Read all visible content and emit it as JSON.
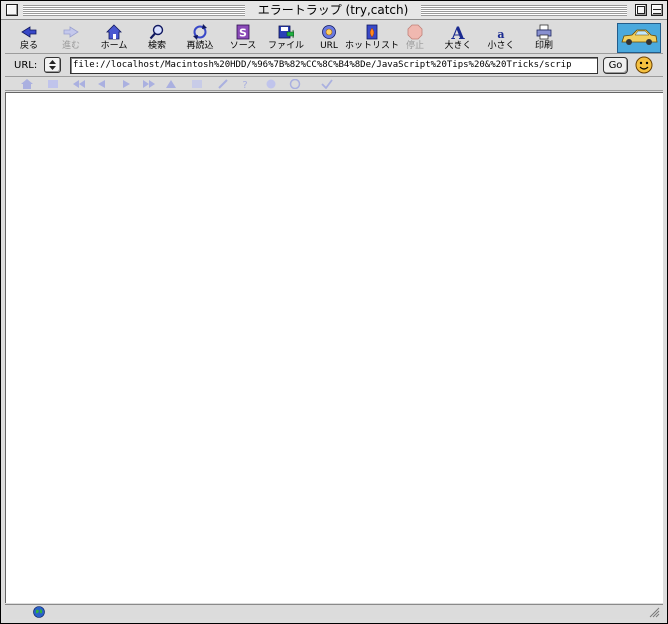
{
  "window": {
    "title": "エラートラップ (try,catch)"
  },
  "toolbar": {
    "buttons": [
      {
        "label": "戻る",
        "icon": "back-icon",
        "enabled": true
      },
      {
        "label": "進む",
        "icon": "forward-icon",
        "enabled": false
      },
      {
        "label": "ホーム",
        "icon": "home-icon",
        "enabled": true
      },
      {
        "label": "検索",
        "icon": "search-icon",
        "enabled": true
      },
      {
        "label": "再読込",
        "icon": "reload-icon",
        "enabled": true
      },
      {
        "label": "ソース",
        "icon": "source-icon",
        "enabled": true
      },
      {
        "label": "ファイル",
        "icon": "file-icon",
        "enabled": true
      },
      {
        "label": "URL",
        "icon": "url-icon",
        "enabled": true
      },
      {
        "label": "ホットリスト",
        "icon": "hotlist-icon",
        "enabled": true
      },
      {
        "label": "停止",
        "icon": "stop-icon",
        "enabled": false
      },
      {
        "label": "大きく",
        "icon": "larger-text-icon",
        "enabled": true
      },
      {
        "label": "小さく",
        "icon": "smaller-text-icon",
        "enabled": true
      },
      {
        "label": "印刷",
        "icon": "print-icon",
        "enabled": true
      }
    ]
  },
  "urlbar": {
    "label": "URL:",
    "value": "file://localhost/Macintosh%20HDD/%96%7B%82%CC%8C%B4%8De/JavaScript%20Tips%20&%20Tricks/scrip",
    "go_label": "Go"
  },
  "colors": {
    "window_bg": "#dddddd",
    "content_bg": "#ffffff",
    "brand_bg": "#4aa9dd",
    "disabled_icon": "#aab0e0"
  }
}
